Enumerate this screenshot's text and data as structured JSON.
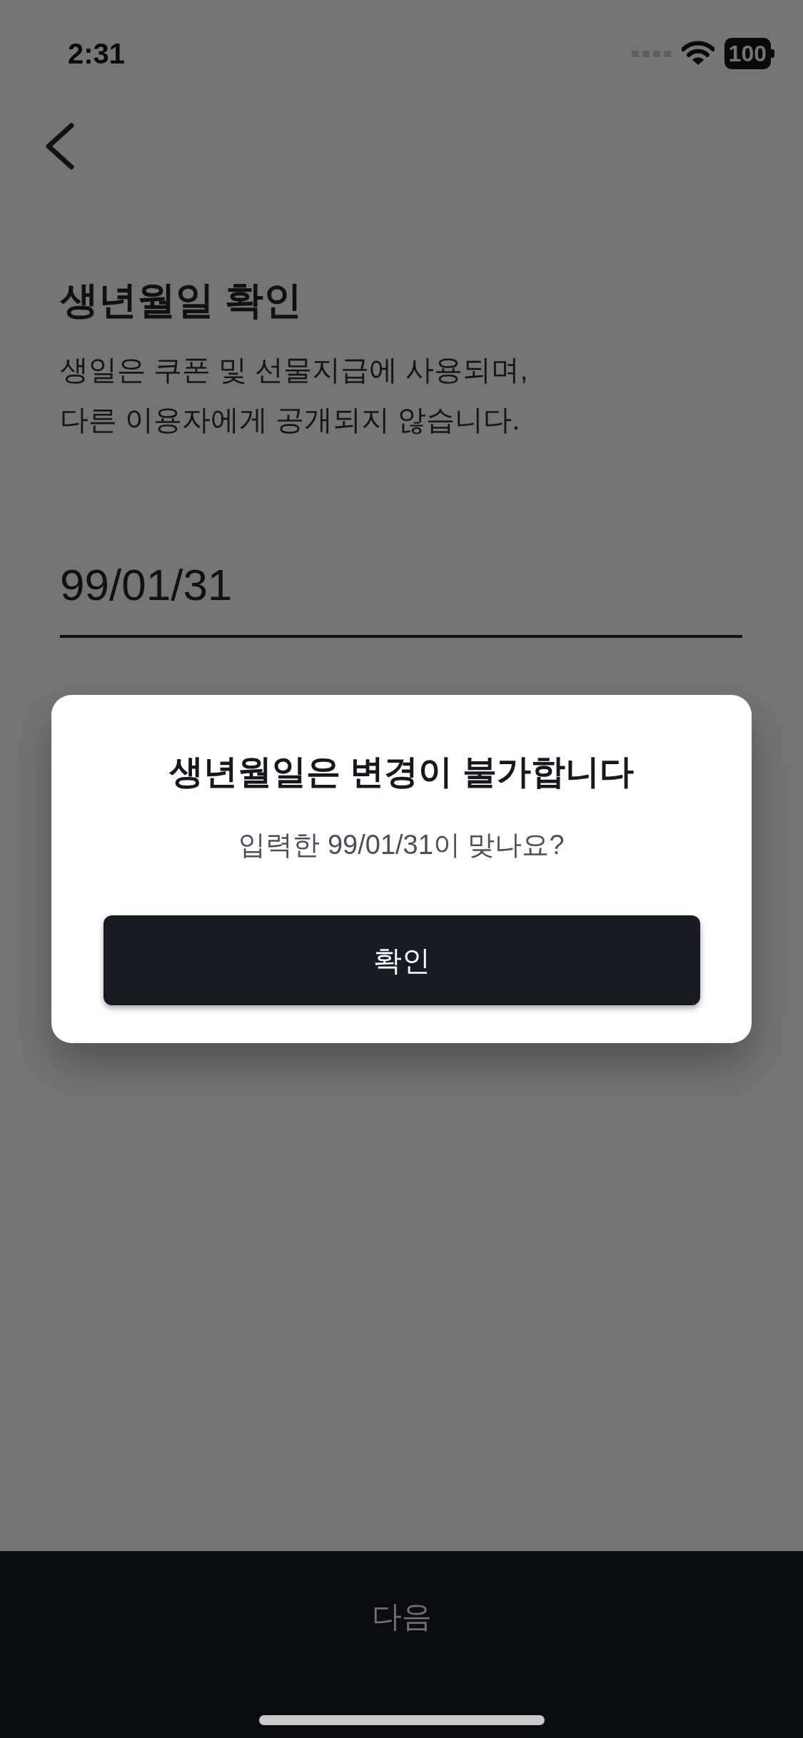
{
  "status_bar": {
    "time": "2:31",
    "battery": "100"
  },
  "header": {
    "title": "생년월일 확인",
    "description_lines": [
      "생일은 쿠폰 및 선물지급에 사용되며,",
      "다른 이용자에게 공개되지 않습니다."
    ]
  },
  "birthdate_field": {
    "value": "99/01/31"
  },
  "dialog": {
    "title": "생년월일은 변경이 불가합니다",
    "message": "입력한 99/01/31이 맞나요?",
    "confirm_button": "확인"
  },
  "bottom_bar": {
    "next_button": "다음"
  }
}
